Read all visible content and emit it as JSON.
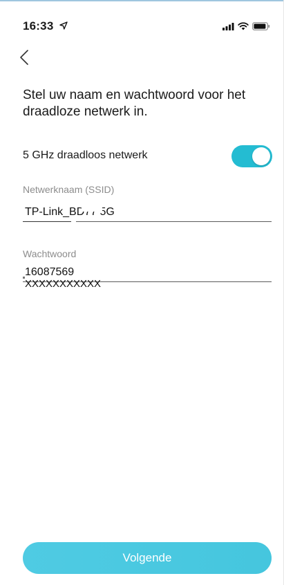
{
  "status_bar": {
    "time": "16:33",
    "icons": [
      "location-arrow-icon",
      "signal-icon",
      "wifi-icon",
      "battery-icon"
    ]
  },
  "navigation": {
    "back_icon": "chevron-left-icon"
  },
  "heading": "Stel uw naam en wachtwoord voor het draadloze netwerk in.",
  "toggle_row": {
    "label": "5 GHz draadloos netwerk",
    "enabled": true,
    "color": "#24bcd2"
  },
  "ssid_field": {
    "label": "Netwerknaam (SSID)",
    "value": "TP-Link_BD77 5G"
  },
  "password_field": {
    "label": "Wachtwoord",
    "value": "16087569",
    "overlay": "XXXXXXXXXXX"
  },
  "primary_button": {
    "label": "Volgende",
    "color": "#4fcbe3"
  }
}
